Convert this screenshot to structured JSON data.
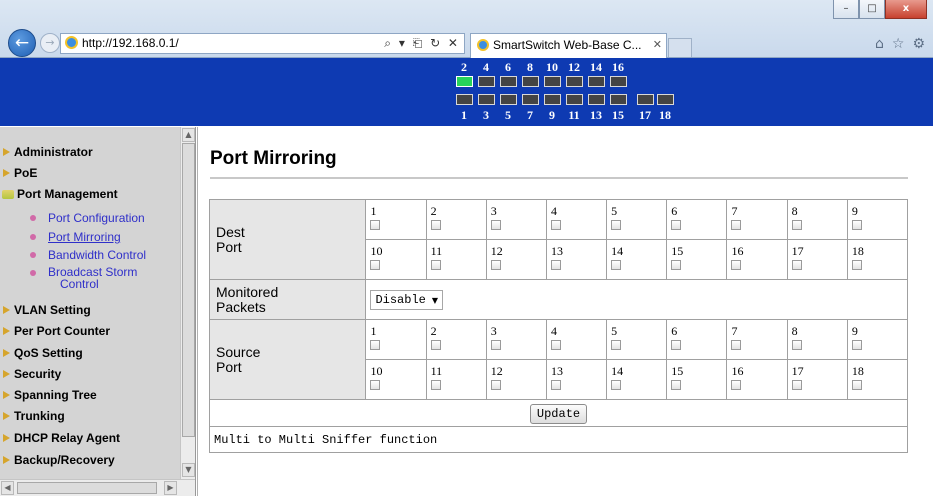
{
  "browser": {
    "address": "http://192.168.0.1/",
    "address_controls": "⌕ ▾ ⎗ ↻ ✕",
    "tab_title": "SmartSwitch Web-Base C...",
    "tab_close": "✕",
    "window_controls": {
      "minimize": "–",
      "maximize": "□",
      "close": "x"
    },
    "tools": [
      "⌂",
      "☆",
      "⚙"
    ]
  },
  "banner": {
    "top_numbers": [
      "2",
      "4",
      "6",
      "8",
      "10",
      "12",
      "14",
      "16"
    ],
    "bottom_numbers": [
      "1",
      "3",
      "5",
      "7",
      "9",
      "11",
      "13",
      "15",
      "17",
      "18"
    ],
    "link_up_port": "2"
  },
  "sidebar": {
    "items": [
      {
        "label": "Administrator",
        "state": "closed"
      },
      {
        "label": "PoE",
        "state": "closed"
      },
      {
        "label": "Port Management",
        "state": "open"
      },
      {
        "label": "VLAN Setting",
        "state": "closed"
      },
      {
        "label": "Per Port Counter",
        "state": "closed"
      },
      {
        "label": "QoS Setting",
        "state": "closed"
      },
      {
        "label": "Security",
        "state": "closed"
      },
      {
        "label": "Spanning Tree",
        "state": "closed"
      },
      {
        "label": "Trunking",
        "state": "closed"
      },
      {
        "label": "DHCP Relay Agent",
        "state": "closed"
      },
      {
        "label": "Backup/Recovery",
        "state": "closed"
      }
    ],
    "sub_items": [
      {
        "label": "Port Configuration"
      },
      {
        "label": "Port Mirroring",
        "active": true
      },
      {
        "label": "Bandwidth Control"
      },
      {
        "label": "Broadcast Storm",
        "label2": "Control"
      }
    ]
  },
  "main": {
    "title": "Port Mirroring",
    "dest_label_1": "Dest",
    "dest_label_2": "Port",
    "monitored_label_1": "Monitored",
    "monitored_label_2": "Packets",
    "monitored_value": "Disable",
    "source_label_1": "Source",
    "source_label_2": "Port",
    "ports_row1": [
      "1",
      "2",
      "3",
      "4",
      "5",
      "6",
      "7",
      "8",
      "9"
    ],
    "ports_row2": [
      "10",
      "11",
      "12",
      "13",
      "14",
      "15",
      "16",
      "17",
      "18"
    ],
    "update_label": "Update",
    "footer_note": "Multi to Multi Sniffer function"
  }
}
